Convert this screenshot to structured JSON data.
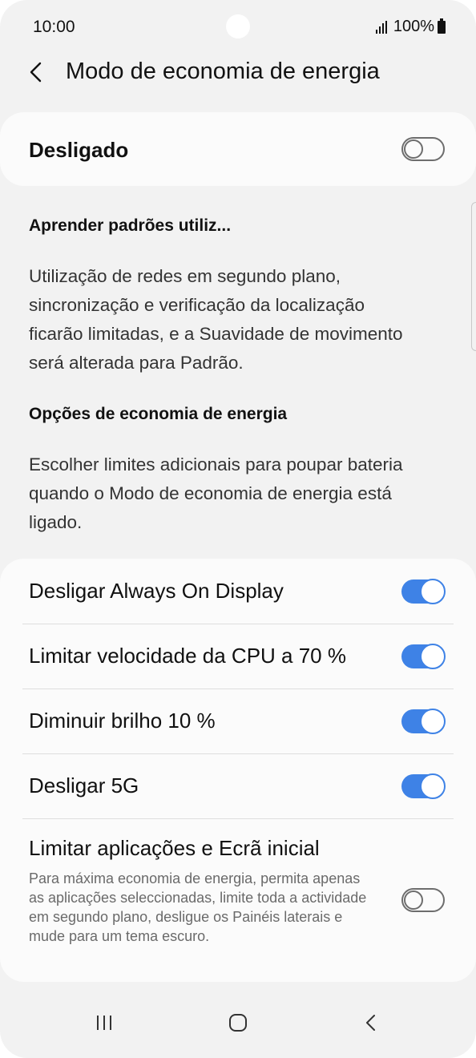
{
  "status_bar": {
    "time": "10:00",
    "battery_text": "100%",
    "icons": [
      "signal-icon",
      "battery-icon"
    ]
  },
  "header": {
    "title": "Modo de economia de energia",
    "back_icon": "chevron-left-icon"
  },
  "master": {
    "label": "Desligado",
    "enabled": false
  },
  "sections": {
    "learn": {
      "heading": "Aprender padrões utiliz...",
      "lines": [
        "Utilização de redes em segundo plano,",
        "sincronização e verificação da localização",
        "ficarão limitadas, e a Suavidade de movimento",
        "será alterada para Padrão."
      ]
    },
    "options": {
      "heading": "Opções de economia de energia",
      "lines": [
        "Escolher limites adicionais para poupar bateria",
        "quando o Modo de economia de energia está",
        "ligado."
      ]
    }
  },
  "options": [
    {
      "label": "Desligar Always On Display",
      "enabled": true
    },
    {
      "label": "Limitar velocidade da CPU a 70 %",
      "enabled": true
    },
    {
      "label": "Diminuir brilho 10 %",
      "enabled": true
    },
    {
      "label": "Desligar 5G",
      "enabled": true
    },
    {
      "label": "Limitar aplicações e Ecrã inicial",
      "description": "Para máxima economia de energia, permita apenas as aplicações seleccionadas, limite toda a actividade em segundo plano, desligue os Painéis laterais e mude para um tema escuro.",
      "enabled": false
    }
  ],
  "colors": {
    "accent": "#3e82e6",
    "background": "#f2f2f2",
    "card": "#fbfbfb",
    "toggle_off": "#6d6d6d"
  },
  "nav_bar": {
    "icons": [
      "recents-icon",
      "home-icon",
      "back-icon"
    ]
  }
}
